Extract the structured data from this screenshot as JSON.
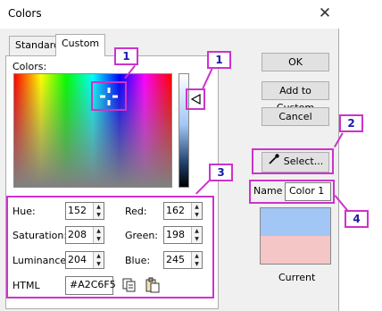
{
  "window": {
    "title": "Colors",
    "close_glyph": "✕"
  },
  "tabs": [
    {
      "label": "Standard"
    },
    {
      "label": "Custom"
    }
  ],
  "custom": {
    "colors_label": "Colors:",
    "fields": {
      "hue": {
        "label": "Hue:",
        "value": "152"
      },
      "saturation": {
        "label": "Saturation:",
        "value": "208"
      },
      "luminance": {
        "label": "Luminance",
        "value": "204"
      },
      "red": {
        "label": "Red:",
        "value": "162"
      },
      "green": {
        "label": "Green:",
        "value": "198"
      },
      "blue": {
        "label": "Blue:",
        "value": "245"
      },
      "html": {
        "label": "HTML",
        "value": "#A2C6F5"
      }
    }
  },
  "buttons": {
    "ok": "OK",
    "add_custom": "Add to Custom",
    "cancel": "Cancel",
    "select": "Select..."
  },
  "name_field": {
    "label": "Name",
    "value": "Color 1"
  },
  "preview": {
    "label": "Current",
    "new_color": "#a2c6f5",
    "current_color": "#f5c6c6"
  },
  "annotations": [
    "1",
    "1",
    "2",
    "3",
    "4"
  ],
  "icons": {
    "eyedropper": "eyedropper-icon",
    "copy": "copy-icon",
    "paste": "paste-icon",
    "pointer": "triangle-pointer-icon",
    "crosshair": "crosshair-icon"
  },
  "annotation_color": "#cc33cc"
}
